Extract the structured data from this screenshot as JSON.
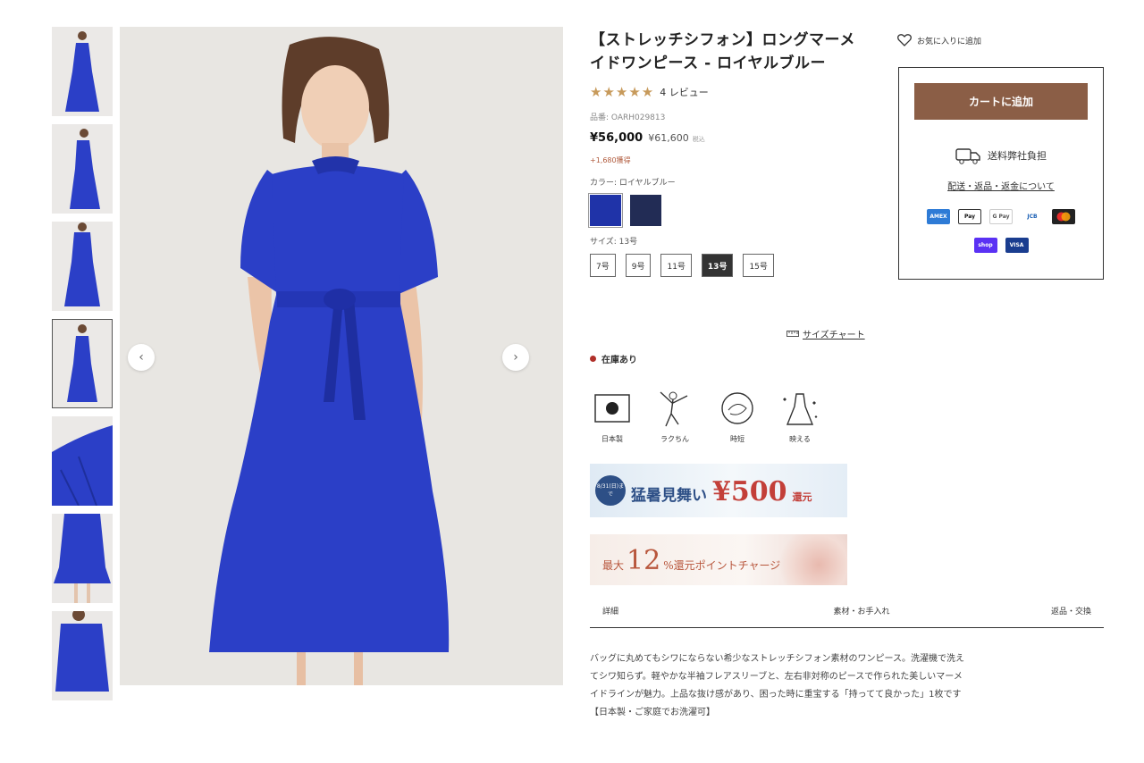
{
  "product": {
    "title": "【ストレッチシフォン】ロングマーメイドワンピース - ロイヤルブルー",
    "stars": "★★★★★",
    "reviews": "4 レビュー",
    "sku": "品番: OARH029813",
    "price": "¥56,000",
    "old_price": "¥61,600",
    "tax_label": "税込",
    "points": "+1,680獲得",
    "color_label": "カラー: ロイヤルブルー",
    "size_label": "サイズ: 13号",
    "rating_fraction": 1.0
  },
  "colors": {
    "accent_brown": "#8b5e46",
    "dress_blue": "#2b3fc7",
    "star": "#c79a5b",
    "stock_dot": "#b0302a"
  },
  "swatches": [
    {
      "name": "royal-blue",
      "color": "#1f33a8"
    },
    {
      "name": "navy",
      "color": "#222c55"
    }
  ],
  "sizes": [
    "7号",
    "9号",
    "11号",
    "13号",
    "15号"
  ],
  "size_chart": "サイズチャート",
  "stock": "在庫あり",
  "features": [
    {
      "icon": "made-in-japan-icon",
      "label": "日本製"
    },
    {
      "icon": "comfort-icon",
      "label": "ラクちん"
    },
    {
      "icon": "time-saving-icon",
      "label": "時短"
    },
    {
      "icon": "flattering-icon",
      "label": "映える"
    }
  ],
  "banners": {
    "b1_badge": "8/31(日)まで",
    "b1_text": "猛暑見舞い",
    "b1_amount": "¥500",
    "b1_unit": "還元",
    "b2_prefix": "最大",
    "b2_num": "12",
    "b2_suffix": "%還元ポイントチャージ"
  },
  "tabs": [
    "詳細",
    "素材・お手入れ",
    "返品・交換"
  ],
  "description": "バッグに丸めてもシワにならない希少なストレッチシフォン素材のワンピース。洗濯機で洗えてシワ知らず。軽やかな半袖フレアスリーブと、左右非対称のピースで作られた美しいマーメイドラインが魅力。上品な抜け感があり、困った時に重宝する「持ってて良かった」1枚です【日本製・ご家庭でお洗濯可】",
  "sidebar": {
    "favorite": "お気に入りに追加",
    "cart_button": "カートに追加",
    "shipping": "送料弊社負担",
    "policy": "配送・返品・返金について",
    "payments_row1": [
      "AMEX",
      "Pay",
      "G Pay",
      "JCB",
      "MC"
    ],
    "payments_row2": [
      "shop",
      "VISA"
    ]
  },
  "gallery": {
    "prev_icon": "chevron-left-icon",
    "next_icon": "chevron-right-icon",
    "prev": "‹",
    "next": "›"
  }
}
